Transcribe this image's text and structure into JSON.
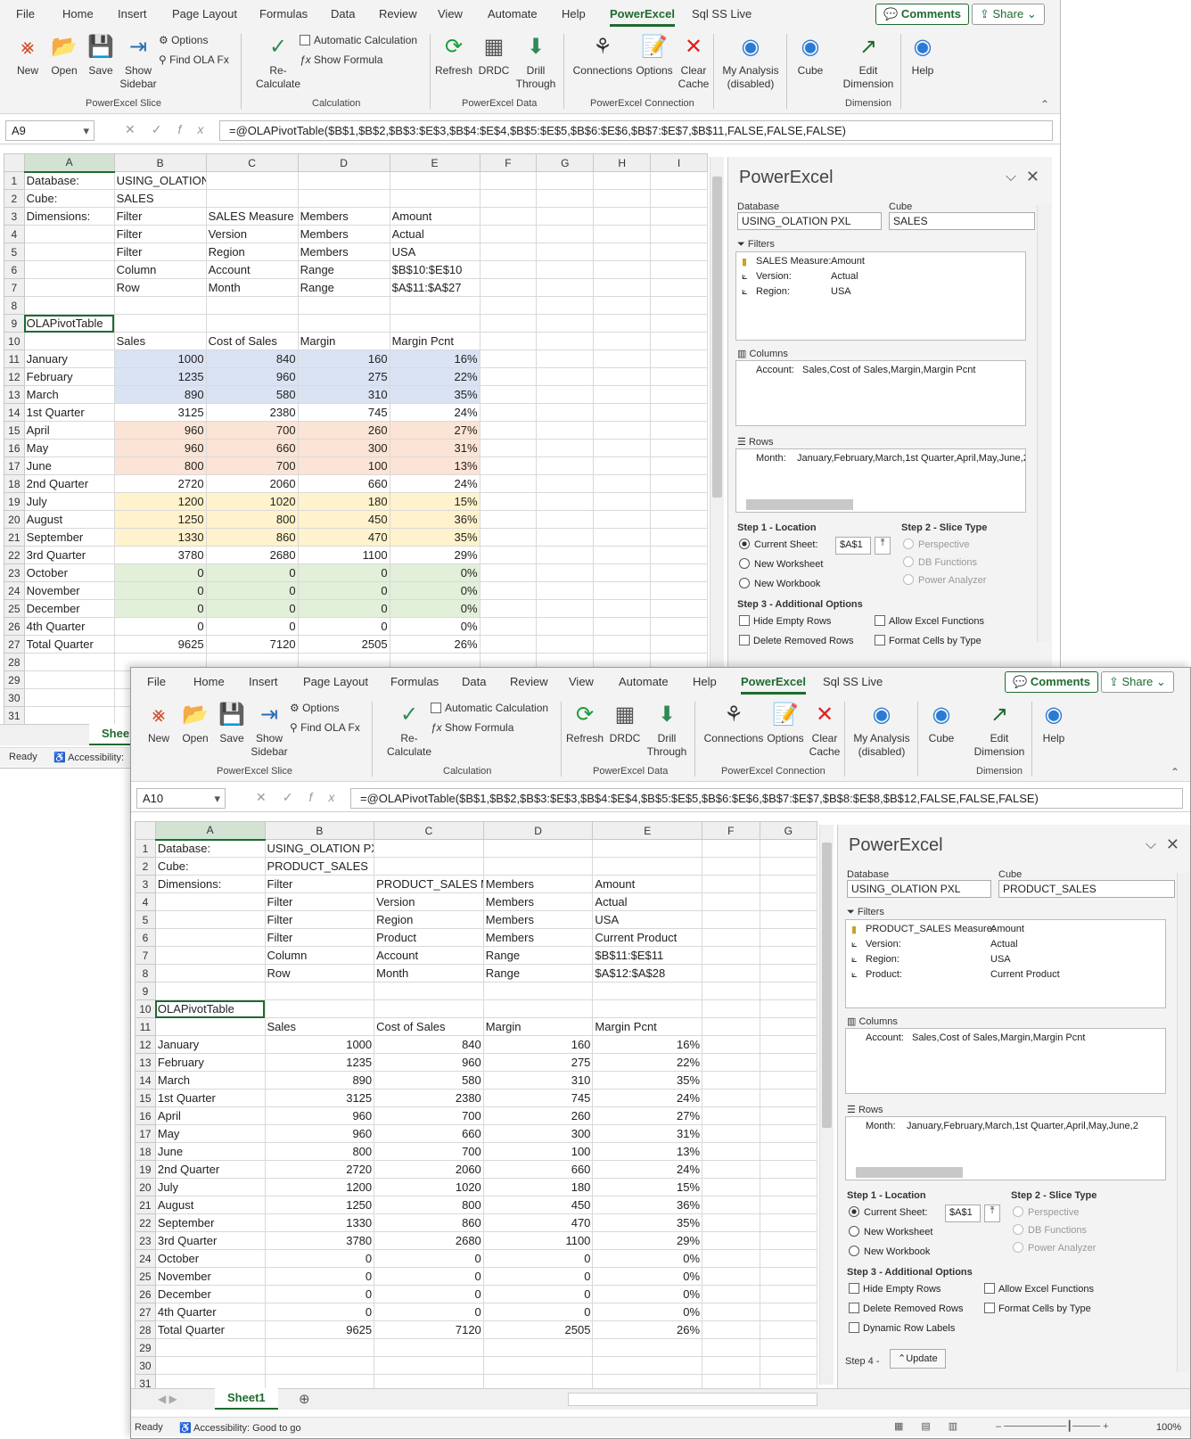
{
  "tabs": [
    "File",
    "Home",
    "Insert",
    "Page Layout",
    "Formulas",
    "Data",
    "Review",
    "View",
    "Automate",
    "Help",
    "PowerExcel",
    "Sql SS Live"
  ],
  "comments": "Comments",
  "share": "Share",
  "ribbon": {
    "new": "New",
    "open": "Open",
    "save": "Save",
    "show_sidebar": "Show Sidebar",
    "options": "Options",
    "find": "Find OLA Fx",
    "recalc": "Re-Calculate",
    "auto_calc": "Automatic Calculation",
    "show_formula": "Show Formula",
    "refresh": "Refresh",
    "drdc": "DRDC",
    "drill": "Drill Through",
    "connections": "Connections",
    "options2": "Options",
    "clear": "Clear Cache",
    "my_analysis": "My Analysis (disabled)",
    "cube": "Cube",
    "edit_dim": "Edit Dimension",
    "help": "Help",
    "g1": "PowerExcel Slice",
    "g2": "Calculation",
    "g3": "PowerExcel Data",
    "g4": "PowerExcel Connection",
    "g5": "Dimension"
  },
  "w1": {
    "namebox": "A9",
    "formula": "=@OLAPivotTable($B$1,$B$2,$B$3:$E$3,$B$4:$E$4,$B$5:$E$5,$B$6:$E$6,$B$7:$E$7,$B$11,FALSE,FALSE,FALSE)",
    "cols": [
      "A",
      "B",
      "C",
      "D",
      "E",
      "F",
      "G",
      "H",
      "I"
    ],
    "rows": [
      [
        "Database:",
        "USING_OLATION PXL",
        "",
        "",
        "",
        ""
      ],
      [
        "Cube:",
        "SALES",
        "",
        "",
        "",
        ""
      ],
      [
        "Dimensions:",
        "Filter",
        "SALES Measure",
        "Members",
        "Amount",
        ""
      ],
      [
        "",
        "Filter",
        "Version",
        "Members",
        "Actual",
        ""
      ],
      [
        "",
        "Filter",
        "Region",
        "Members",
        "USA",
        ""
      ],
      [
        "",
        "Column",
        "Account",
        "Range",
        "$B$10:$E$10",
        ""
      ],
      [
        "",
        "Row",
        "Month",
        "Range",
        "$A$11:$A$27",
        ""
      ],
      [
        "",
        "",
        "",
        "",
        "",
        ""
      ],
      [
        "OLAPivotTable",
        "",
        "",
        "",
        "",
        ""
      ],
      [
        "",
        "Sales",
        "Cost of Sales",
        "Margin",
        "Margin Pcnt",
        ""
      ],
      [
        "January",
        "1000",
        "840",
        "160",
        "16%",
        "c1"
      ],
      [
        "February",
        "1235",
        "960",
        "275",
        "22%",
        "c1"
      ],
      [
        "March",
        "890",
        "580",
        "310",
        "35%",
        "c1"
      ],
      [
        "1st Quarter",
        "3125",
        "2380",
        "745",
        "24%",
        ""
      ],
      [
        "April",
        "960",
        "700",
        "260",
        "27%",
        "c2"
      ],
      [
        "May",
        "960",
        "660",
        "300",
        "31%",
        "c2"
      ],
      [
        "June",
        "800",
        "700",
        "100",
        "13%",
        "c2"
      ],
      [
        "2nd Quarter",
        "2720",
        "2060",
        "660",
        "24%",
        ""
      ],
      [
        "July",
        "1200",
        "1020",
        "180",
        "15%",
        "c3"
      ],
      [
        "August",
        "1250",
        "800",
        "450",
        "36%",
        "c3"
      ],
      [
        "September",
        "1330",
        "860",
        "470",
        "35%",
        "c3"
      ],
      [
        "3rd Quarter",
        "3780",
        "2680",
        "1100",
        "29%",
        ""
      ],
      [
        "October",
        "0",
        "0",
        "0",
        "0%",
        "c4"
      ],
      [
        "November",
        "0",
        "0",
        "0",
        "0%",
        "c4"
      ],
      [
        "December",
        "0",
        "0",
        "0",
        "0%",
        "c4"
      ],
      [
        "4th Quarter",
        "0",
        "0",
        "0",
        "0%",
        ""
      ],
      [
        "Total Quarter",
        "9625",
        "7120",
        "2505",
        "26%",
        ""
      ],
      [
        "",
        "",
        "",
        "",
        "",
        ""
      ],
      [
        "",
        "",
        "",
        "",
        "",
        ""
      ],
      [
        "",
        "",
        "",
        "",
        "",
        ""
      ],
      [
        "",
        "",
        "",
        "",
        "",
        ""
      ]
    ],
    "sheet": "Shee",
    "status": "Ready",
    "access": "Accessibility:"
  },
  "w2": {
    "namebox": "A10",
    "formula": "=@OLAPivotTable($B$1,$B$2,$B$3:$E$3,$B$4:$E$4,$B$5:$E$5,$B$6:$E$6,$B$7:$E$7,$B$8:$E$8,$B$12,FALSE,FALSE,FALSE)",
    "cols": [
      "A",
      "B",
      "C",
      "D",
      "E",
      "F",
      "G"
    ],
    "rows": [
      [
        "Database:",
        "USING_OLATION  PXL",
        "",
        "",
        "",
        ""
      ],
      [
        "Cube:",
        "PRODUCT_SALES",
        "",
        "",
        "",
        ""
      ],
      [
        "Dimensions:",
        "Filter",
        "PRODUCT_SALES Me",
        "Members",
        "Amount",
        ""
      ],
      [
        "",
        "Filter",
        "Version",
        "Members",
        "Actual",
        ""
      ],
      [
        "",
        "Filter",
        "Region",
        "Members",
        "USA",
        ""
      ],
      [
        "",
        "Filter",
        "Product",
        "Members",
        "Current Product",
        ""
      ],
      [
        "",
        "Column",
        "Account",
        "Range",
        "$B$11:$E$11",
        ""
      ],
      [
        "",
        "Row",
        "Month",
        "Range",
        "$A$12:$A$28",
        ""
      ],
      [
        "",
        "",
        "",
        "",
        "",
        ""
      ],
      [
        "OLAPivotTable",
        "",
        "",
        "",
        "",
        ""
      ],
      [
        "",
        "Sales",
        "Cost of Sales",
        "Margin",
        "Margin Pcnt",
        ""
      ],
      [
        "January",
        "1000",
        "840",
        "160",
        "16%",
        ""
      ],
      [
        "February",
        "1235",
        "960",
        "275",
        "22%",
        ""
      ],
      [
        "March",
        "890",
        "580",
        "310",
        "35%",
        ""
      ],
      [
        "1st Quarter",
        "3125",
        "2380",
        "745",
        "24%",
        ""
      ],
      [
        "April",
        "960",
        "700",
        "260",
        "27%",
        ""
      ],
      [
        "May",
        "960",
        "660",
        "300",
        "31%",
        ""
      ],
      [
        "June",
        "800",
        "700",
        "100",
        "13%",
        ""
      ],
      [
        "2nd Quarter",
        "2720",
        "2060",
        "660",
        "24%",
        ""
      ],
      [
        "July",
        "1200",
        "1020",
        "180",
        "15%",
        ""
      ],
      [
        "August",
        "1250",
        "800",
        "450",
        "36%",
        ""
      ],
      [
        "September",
        "1330",
        "860",
        "470",
        "35%",
        ""
      ],
      [
        "3rd Quarter",
        "3780",
        "2680",
        "1100",
        "29%",
        ""
      ],
      [
        "October",
        "0",
        "0",
        "0",
        "0%",
        ""
      ],
      [
        "November",
        "0",
        "0",
        "0",
        "0%",
        ""
      ],
      [
        "December",
        "0",
        "0",
        "0",
        "0%",
        ""
      ],
      [
        "4th Quarter",
        "0",
        "0",
        "0",
        "0%",
        ""
      ],
      [
        "Total Quarter",
        "9625",
        "7120",
        "2505",
        "26%",
        ""
      ],
      [
        "",
        "",
        "",
        "",
        "",
        ""
      ],
      [
        "",
        "",
        "",
        "",
        "",
        ""
      ],
      [
        "",
        "",
        "",
        "",
        "",
        ""
      ]
    ],
    "sheet": "Sheet1",
    "status": "Ready",
    "access": "Accessibility: Good to go",
    "zoom": "100%"
  },
  "pane": {
    "title": "PowerExcel",
    "db_label": "Database",
    "cube_label": "Cube",
    "filters": "Filters",
    "columns": "Columns",
    "rows": "Rows",
    "step1": "Step 1 - Location",
    "step2": "Step 2 - Slice Type",
    "step3": "Step 3 - Additional Options",
    "step4": "Step 4 -",
    "current": "Current Sheet:",
    "cell": "$A$1",
    "new_ws": "New Worksheet",
    "new_wb": "New Workbook",
    "persp": "Perspective",
    "dbf": "DB Functions",
    "pa": "Power Analyzer",
    "hide": "Hide Empty Rows",
    "allow": "Allow Excel Functions",
    "del": "Delete Removed Rows",
    "fmt": "Format Cells by Type",
    "dyn": "Dynamic Row Labels",
    "update": "Update",
    "p1": {
      "db": "USING_OLATION PXL",
      "cube": "SALES",
      "f": [
        [
          "SALES Measure:",
          "Amount"
        ],
        [
          "Version:",
          "Actual"
        ],
        [
          "Region:",
          "USA"
        ]
      ],
      "col": [
        "Account:",
        "Sales,Cost of Sales,Margin,Margin Pcnt"
      ],
      "row": [
        "Month:",
        "January,February,March,1st Quarter,April,May,June,2"
      ]
    },
    "p2": {
      "db": "USING_OLATION  PXL",
      "cube": "PRODUCT_SALES",
      "f": [
        [
          "PRODUCT_SALES Measure:",
          "Amount"
        ],
        [
          "Version:",
          "Actual"
        ],
        [
          "Region:",
          "USA"
        ],
        [
          "Product:",
          "Current Product"
        ]
      ],
      "col": [
        "Account:",
        "Sales,Cost of Sales,Margin,Margin Pcnt"
      ],
      "row": [
        "Month:",
        "January,February,March,1st Quarter,April,May,June,2"
      ]
    }
  }
}
